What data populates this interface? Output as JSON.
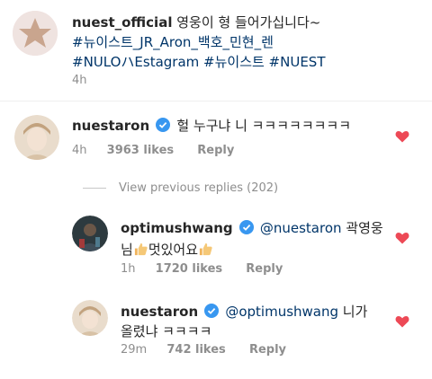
{
  "post": {
    "username": "nuest_official",
    "caption": " 영웅이 형 들어가십니다~",
    "tags_line1": "#뉴이스트_JR_Aron_백호_민현_렌",
    "tags_line2": "#NULOハEstagram #뉴이스트 #NUEST",
    "time": "4h"
  },
  "comments": [
    {
      "username": "nuestaron",
      "text": "헐 누구냐 니 ㅋㅋㅋㅋㅋㅋㅋㅋ",
      "time": "4h",
      "likes": "3963 likes",
      "reply": "Reply"
    }
  ],
  "view_previous": "View previous replies (202)",
  "replies": [
    {
      "username": "optimushwang",
      "mention": "@nuestaron",
      "text_line1_suffix": " 곽영웅",
      "text_line2_a": "님",
      "text_line2_b": "멋있어요",
      "time": "1h",
      "likes": "1720 likes",
      "reply": "Reply"
    },
    {
      "username": "nuestaron",
      "mention": "@optimushwang",
      "text_line1_suffix": " 니가",
      "text_line2": "올렸냐 ㅋㅋㅋㅋ",
      "time": "29m",
      "likes": "742 likes",
      "reply": "Reply"
    }
  ],
  "colors": {
    "like_heart": "#ed4956",
    "verified": "#3897f0",
    "hashtag": "#003569",
    "meta": "#8e8e8e"
  },
  "icons": [
    "verified-badge-icon",
    "heart-icon",
    "thumbs-up-icon"
  ]
}
